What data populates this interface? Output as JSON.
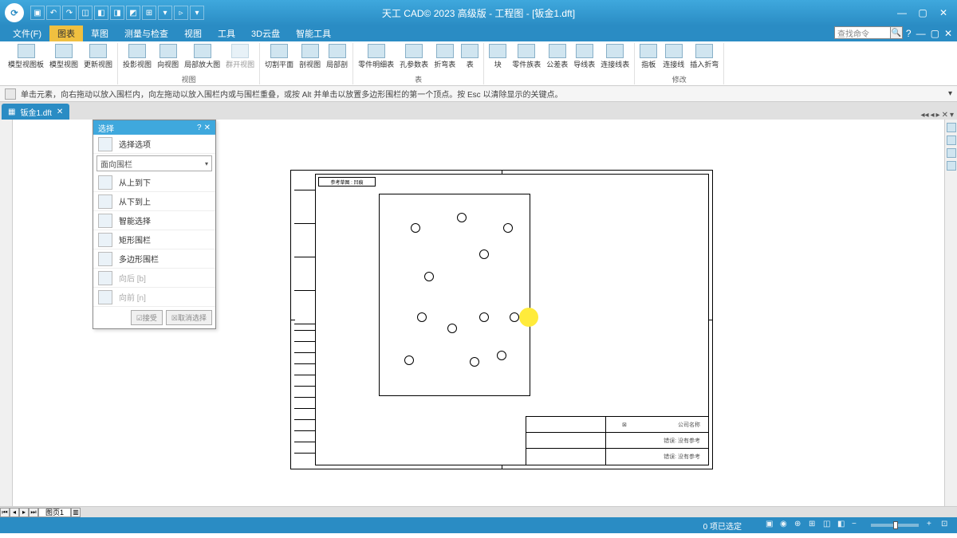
{
  "app_title": "天工 CAD© 2023 高级版 - 工程图 - [钣金1.dft]",
  "search_placeholder": "查找命令",
  "menu": {
    "file": "文件(F)",
    "draw": "图表",
    "sketch": "草图",
    "measure": "测量与检查",
    "view": "视图",
    "tools": "工具",
    "cloud3d": "3D云盘",
    "smart": "智能工具"
  },
  "ribbon": {
    "g1": {
      "b1": "模型视图板",
      "b2": "模型视图",
      "b3": "更新视图"
    },
    "g2": {
      "b1": "投影视图",
      "b2": "向视图",
      "b3": "局部放大图",
      "b4": "群开视图",
      "label": "视图"
    },
    "g3": {
      "b1": "切割平面",
      "b2": "剖视图",
      "b3": "局部剖"
    },
    "g4": {
      "b1": "零件明细表",
      "b2": "孔参数表",
      "b3": "折弯表",
      "b4": "表",
      "label": "表"
    },
    "g5": {
      "b1": "块",
      "b2": "零件族表",
      "b3": "公差表",
      "b4": "导线表",
      "b5": "连接线表"
    },
    "g6": {
      "b1": "指板",
      "b2": "连接线",
      "b3": "插入折弯",
      "label": "修改"
    }
  },
  "hint": "单击元素，向右拖动以放入围栏内，向左拖动以放入围栏内或与围栏重叠，或按 Alt 并单击以放置多边形围栏的第一个顶点。按 Esc 以清除显示的关键点。",
  "doc_tab": "钣金1.dft",
  "panel": {
    "title": "选择",
    "opt": "选择选项",
    "dropdown": "面向围栏",
    "r1": "从上到下",
    "r2": "从下到上",
    "r3": "智能选择",
    "r4": "矩形围栏",
    "r5": "多边形围栏",
    "r6": "向后 [b]",
    "r7": "向前 [n]",
    "btn1": "接受",
    "btn2": "取消选择"
  },
  "sheet": {
    "header": "参考草图 : 凹痕",
    "company": "公司名称",
    "err1": "错误: 没有参考",
    "err2": "错误: 没有参考"
  },
  "sheet_tab": "图页1",
  "status": {
    "selected": "0 项已选定"
  }
}
